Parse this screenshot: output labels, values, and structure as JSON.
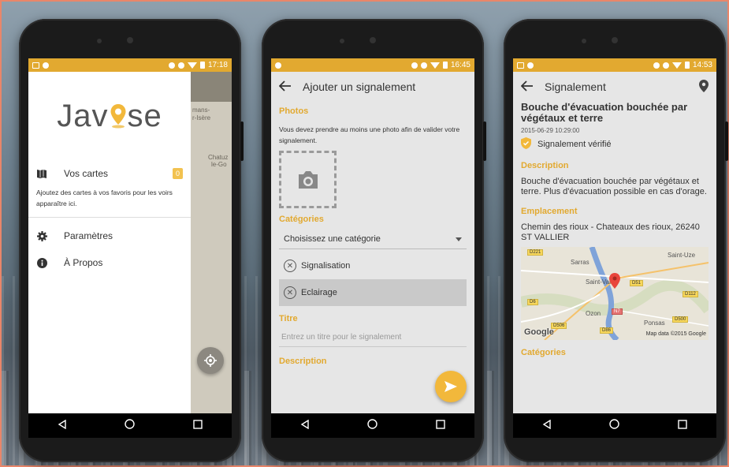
{
  "screen1": {
    "status_time": "17:18",
    "logo_left": "Jav",
    "logo_right": "se",
    "menu": {
      "maps_label": "Vos cartes",
      "maps_badge": "0",
      "maps_hint": "Ajoutez des cartes à vos favoris pour les voirs apparaître ici.",
      "settings_label": "Paramètres",
      "about_label": "À Propos"
    },
    "map_labels": [
      "mans-",
      "r-Isère",
      "Chatuz",
      "le-Go"
    ]
  },
  "screen2": {
    "status_time": "16:45",
    "title": "Ajouter un signalement",
    "photos_title": "Photos",
    "photos_hint": "Vous devez prendre au moins une photo afin de valider votre signalement.",
    "categories_title": "Catégories",
    "category_placeholder": "Choisissez une catégorie",
    "categories": [
      {
        "label": "Signalisation",
        "selected": false
      },
      {
        "label": "Eclairage",
        "selected": true
      }
    ],
    "titre_title": "Titre",
    "titre_placeholder": "Entrez un titre pour le signalement",
    "description_title": "Description"
  },
  "screen3": {
    "status_time": "14:53",
    "title": "Signalement",
    "report_title": "Bouche d'évacuation bouchée par végétaux et terre",
    "date": "2015-06-29 10:29:00",
    "verified": "Signalement vérifié",
    "description_title": "Description",
    "description": "Bouche d'évacuation bouchée par végétaux et terre. Plus d'évacuation possible en cas d'orage.",
    "location_title": "Emplacement",
    "address": "Chemin des rioux - Chateaux des rioux, 26240 ST VALLIER",
    "map_places": [
      "Sarras",
      "Saint-Uze",
      "Saint-Vallier",
      "Ozon",
      "Ponsas"
    ],
    "map_roads": [
      "D221",
      "D51",
      "D112",
      "D6",
      "N7",
      "D500",
      "D506",
      "D86"
    ],
    "map_google": "Google",
    "map_attribution": "Map data ©2015 Google",
    "categories_title": "Catégories"
  },
  "colors": {
    "accent": "#e2a930",
    "fab": "#f2b83b"
  }
}
